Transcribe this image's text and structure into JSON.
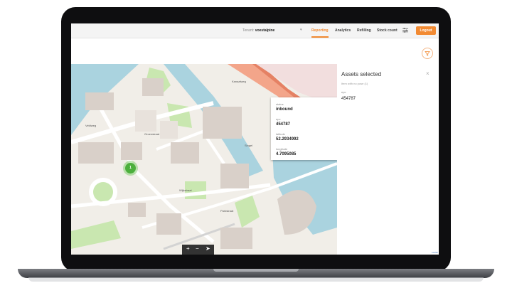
{
  "topbar": {
    "tenant_label": "Tenant:",
    "tenant_value": "voestalpine",
    "nav": [
      "Reporting",
      "Analytics",
      "Refilling",
      "Stock count"
    ],
    "active_nav": "Reporting",
    "logout_label": "Logout"
  },
  "map": {
    "marker_count": "1",
    "street_labels": [
      "Veldweg",
      "Groenstraat",
      "Wijkstraat",
      "Parkstraat",
      "Kanaalweg",
      "Singel"
    ],
    "toolbar": {
      "add": "+",
      "remove": "−",
      "locate": "➤"
    }
  },
  "popup": {
    "status_label": "status",
    "status_value": "inbound",
    "epc_label": "epc",
    "epc_value": "454787",
    "latitude_label": "latitude",
    "latitude_value": "52.2934992",
    "longitude_label": "longitude",
    "longitude_value": "4.7095085"
  },
  "panel": {
    "title": "Assets selected",
    "close": "×",
    "subtitle": "Item with no pose (1)",
    "epc_label": "epc",
    "epc_value": "454787"
  },
  "attribution": "Leaflet",
  "colors": {
    "accent": "#f28a32",
    "marker": "#4caf3c",
    "water": "#aad3df"
  }
}
